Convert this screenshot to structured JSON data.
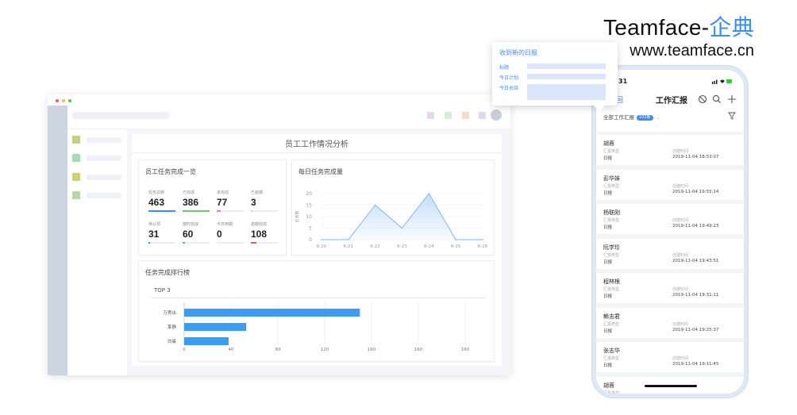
{
  "brand": {
    "name": "Teamface-",
    "name_cn": "企典",
    "url": "www.teamface.cn"
  },
  "dashboard": {
    "title": "员工工作情况分析",
    "header_square_colors": [
      "#e7d6f0",
      "#d7ecd6",
      "#f6dcc4",
      "#dcd9f2"
    ],
    "sidebar_icon_colors": [
      "#bcd67c",
      "#a6dcb6",
      "#cfd06e",
      "#b9d7a9"
    ],
    "task_summary": {
      "title": "员工任务完成一览",
      "stats": [
        {
          "label": "任务总数",
          "value": "463",
          "color": "#3b8df0",
          "progress": 1.0
        },
        {
          "label": "已完成",
          "value": "386",
          "color": "#6cc46c",
          "progress": 1.0
        },
        {
          "label": "未完成",
          "value": "77",
          "color": "#f08080",
          "progress": 0.15
        },
        {
          "label": "已逾期",
          "value": "3",
          "color": "#f4c3c3",
          "progress": 0.05
        },
        {
          "label": "待认领",
          "value": "31",
          "color": "#3b8df0",
          "progress": 0.05
        },
        {
          "label": "按时完成",
          "value": "60",
          "color": "#6cc46c",
          "progress": 0.1
        },
        {
          "label": "今日到期",
          "value": "0",
          "color": "#f6d0c0",
          "progress": 0.0
        },
        {
          "label": "逾期完成",
          "value": "108",
          "color": "#e06060",
          "progress": 0.2
        }
      ]
    },
    "daily_chart": {
      "title": "每日任务完成量",
      "ylabel": "任务数"
    },
    "ranking": {
      "title": "任务完成排行榜",
      "subtitle": "TOP 3"
    }
  },
  "chart_data": [
    {
      "type": "area",
      "title": "每日任务完成量",
      "ylabel": "任务数",
      "x": [
        "6-20",
        "6-21",
        "6-22",
        "6-23",
        "6-24",
        "6-25",
        "6-26"
      ],
      "values": [
        0,
        0,
        15,
        5,
        20,
        0,
        0
      ],
      "ylim": [
        0,
        20
      ],
      "yticks": [
        0,
        5,
        10,
        15,
        20
      ],
      "color": "#7fb7f2"
    },
    {
      "type": "bar",
      "title": "任务完成排行榜",
      "categories": [
        "万秀出",
        "某静",
        "白晨"
      ],
      "values": [
        150,
        53,
        38
      ],
      "xlim": [
        0,
        160
      ],
      "xticks": [
        0,
        40,
        80,
        120,
        160,
        160,
        160
      ],
      "color": "#3b9cf4"
    }
  ],
  "popup": {
    "title": "收到新的日报",
    "rows": [
      "标题",
      "今日计划",
      "今日总结"
    ]
  },
  "phone": {
    "time": "31",
    "back_label": "回",
    "title": "工作汇报",
    "filter_label": "全部工作汇报",
    "filter_badge": "103条",
    "type_label": "汇报类型",
    "type_value": "日报",
    "created_label": "创建时间",
    "reports": [
      {
        "name": "胡蓉",
        "time": "2019-11-04 18:53:07"
      },
      {
        "name": "彭华妹",
        "time": "2019-11-04 19:55:14"
      },
      {
        "name": "杨联刚",
        "time": "2019-11-04 19:49:23"
      },
      {
        "name": "阮学珍",
        "time": "2019-11-04 19:43:51"
      },
      {
        "name": "程林根",
        "time": "2019-11-04 19:31:11"
      },
      {
        "name": "赖志君",
        "time": "2019-11-04 19:25:37"
      },
      {
        "name": "张志华",
        "time": "2019-11-04 19:11:45"
      },
      {
        "name": "胡蓉",
        "time": ""
      }
    ]
  }
}
